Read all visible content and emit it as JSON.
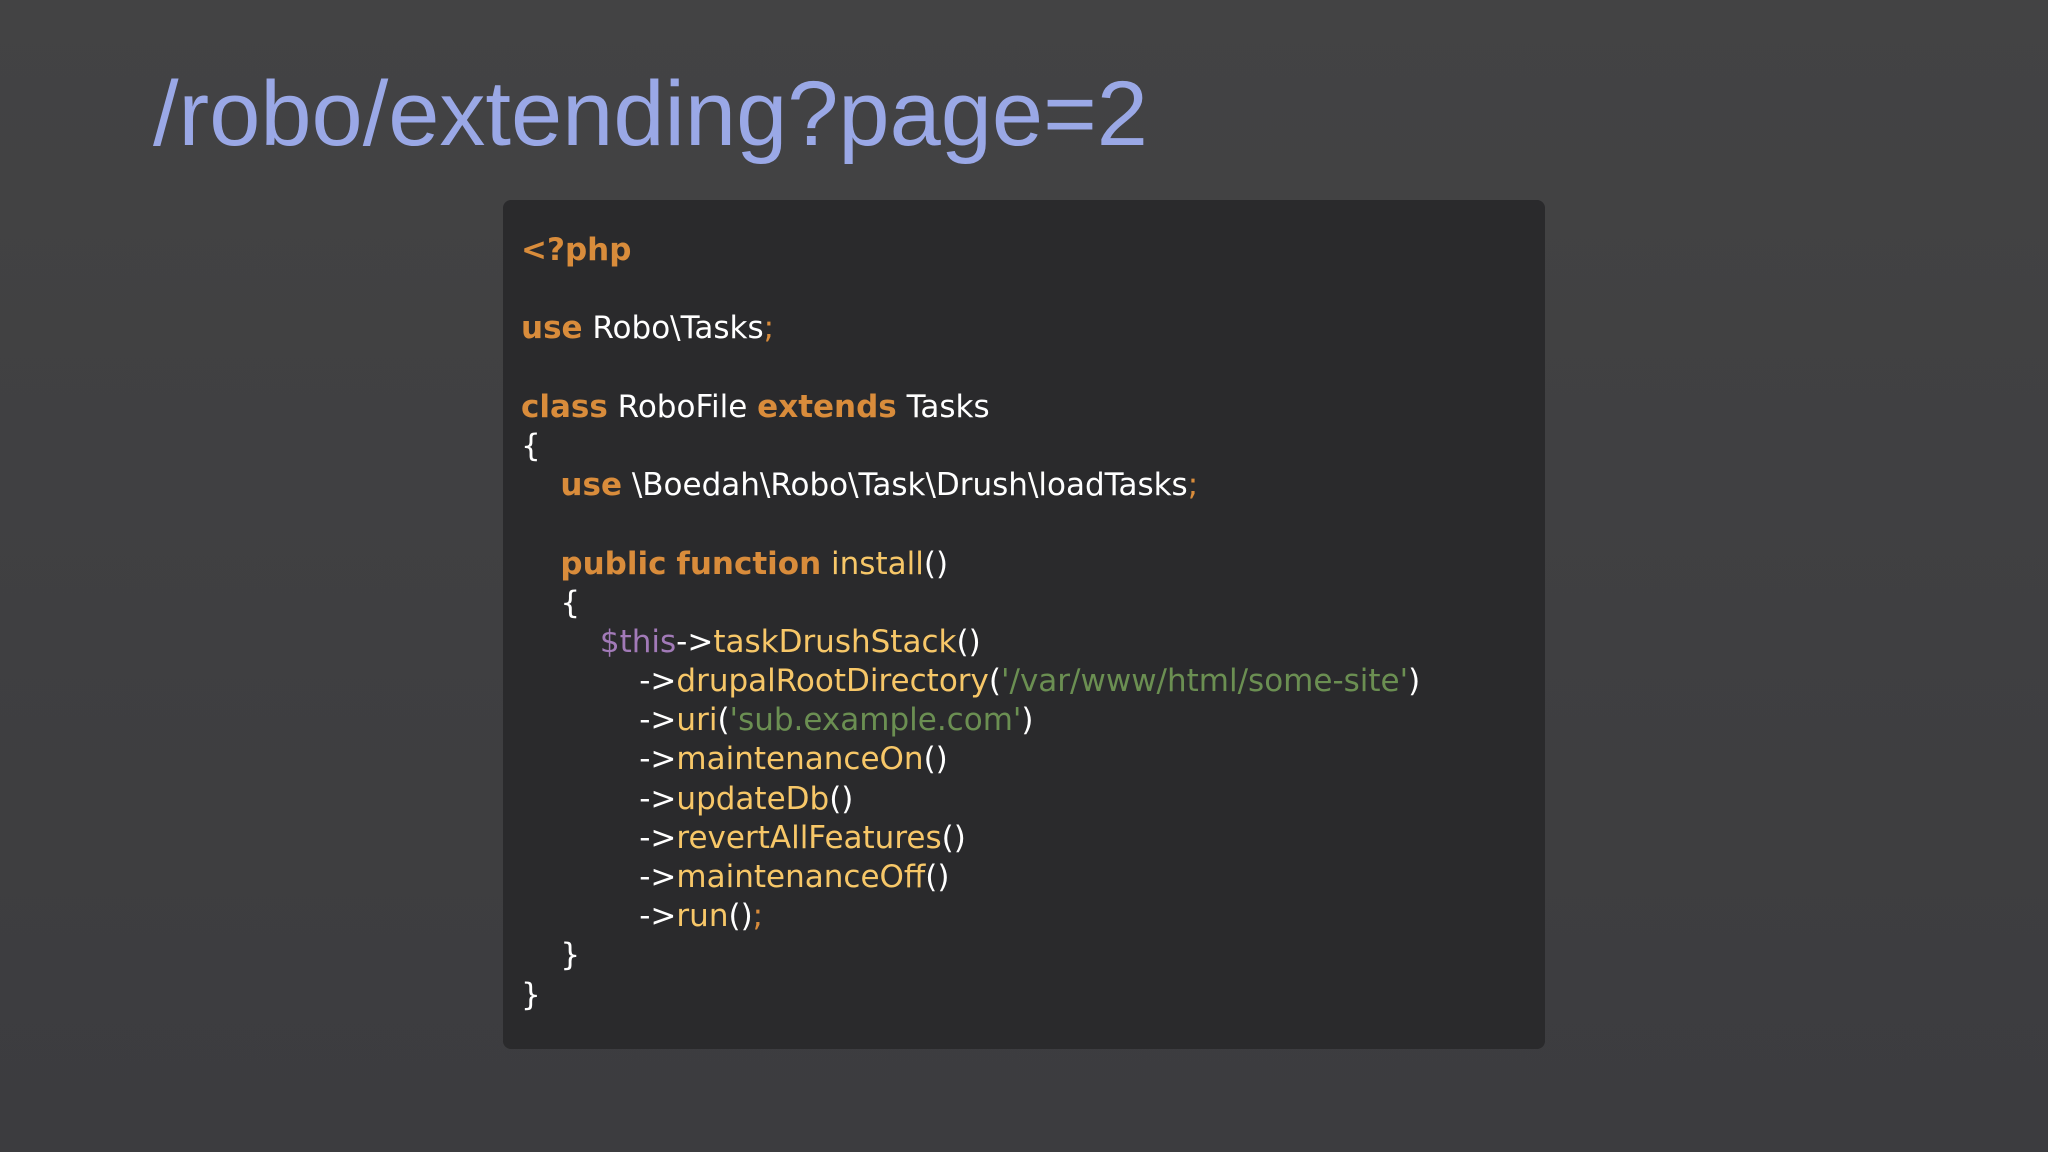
{
  "title": "/robo/extending?page=2",
  "code": {
    "language": "php",
    "lines": [
      [
        {
          "t": "<?php",
          "c": "kw"
        }
      ],
      [],
      [
        {
          "t": "use",
          "c": "kw"
        },
        {
          "t": " Robo\\Tasks",
          "c": "plain"
        },
        {
          "t": ";",
          "c": "semi"
        }
      ],
      [],
      [
        {
          "t": "class",
          "c": "kw"
        },
        {
          "t": " RoboFile ",
          "c": "plain"
        },
        {
          "t": "extends",
          "c": "kw"
        },
        {
          "t": " Tasks",
          "c": "plain"
        }
      ],
      [
        {
          "t": "{",
          "c": "plain"
        }
      ],
      [
        {
          "t": "    ",
          "c": "plain"
        },
        {
          "t": "use",
          "c": "kw"
        },
        {
          "t": " \\Boedah\\Robo\\Task\\Drush\\loadTasks",
          "c": "plain"
        },
        {
          "t": ";",
          "c": "semi"
        }
      ],
      [],
      [
        {
          "t": "    ",
          "c": "plain"
        },
        {
          "t": "public",
          "c": "kw"
        },
        {
          "t": " ",
          "c": "plain"
        },
        {
          "t": "function",
          "c": "kw"
        },
        {
          "t": " install",
          "c": "fn"
        },
        {
          "t": "()",
          "c": "plain"
        }
      ],
      [
        {
          "t": "    {",
          "c": "plain"
        }
      ],
      [
        {
          "t": "        ",
          "c": "plain"
        },
        {
          "t": "$this",
          "c": "var"
        },
        {
          "t": "->",
          "c": "plain"
        },
        {
          "t": "taskDrushStack",
          "c": "fn"
        },
        {
          "t": "()",
          "c": "plain"
        }
      ],
      [
        {
          "t": "            ->",
          "c": "plain"
        },
        {
          "t": "drupalRootDirectory",
          "c": "fn"
        },
        {
          "t": "(",
          "c": "plain"
        },
        {
          "t": "'/var/www/html/some-site'",
          "c": "str"
        },
        {
          "t": ")",
          "c": "plain"
        }
      ],
      [
        {
          "t": "            ->",
          "c": "plain"
        },
        {
          "t": "uri",
          "c": "fn"
        },
        {
          "t": "(",
          "c": "plain"
        },
        {
          "t": "'sub.example.com'",
          "c": "str"
        },
        {
          "t": ")",
          "c": "plain"
        }
      ],
      [
        {
          "t": "            ->",
          "c": "plain"
        },
        {
          "t": "maintenanceOn",
          "c": "fn"
        },
        {
          "t": "()",
          "c": "plain"
        }
      ],
      [
        {
          "t": "            ->",
          "c": "plain"
        },
        {
          "t": "updateDb",
          "c": "fn"
        },
        {
          "t": "()",
          "c": "plain"
        }
      ],
      [
        {
          "t": "            ->",
          "c": "plain"
        },
        {
          "t": "revertAllFeatures",
          "c": "fn"
        },
        {
          "t": "()",
          "c": "plain"
        }
      ],
      [
        {
          "t": "            ->",
          "c": "plain"
        },
        {
          "t": "maintenanceOff",
          "c": "fn"
        },
        {
          "t": "()",
          "c": "plain"
        }
      ],
      [
        {
          "t": "            ->",
          "c": "plain"
        },
        {
          "t": "run",
          "c": "fn"
        },
        {
          "t": "()",
          "c": "plain"
        },
        {
          "t": ";",
          "c": "semi"
        }
      ],
      [
        {
          "t": "    }",
          "c": "plain"
        }
      ],
      [
        {
          "t": "}",
          "c": "plain"
        }
      ]
    ]
  },
  "colors": {
    "background": "#414143",
    "title": "#9aa8e6",
    "code_background": "#2a2a2c",
    "keyword": "#d98c3b",
    "identifier": "#ffffff",
    "function": "#f7c768",
    "string": "#6b8f52",
    "variable": "#a27ab8"
  }
}
